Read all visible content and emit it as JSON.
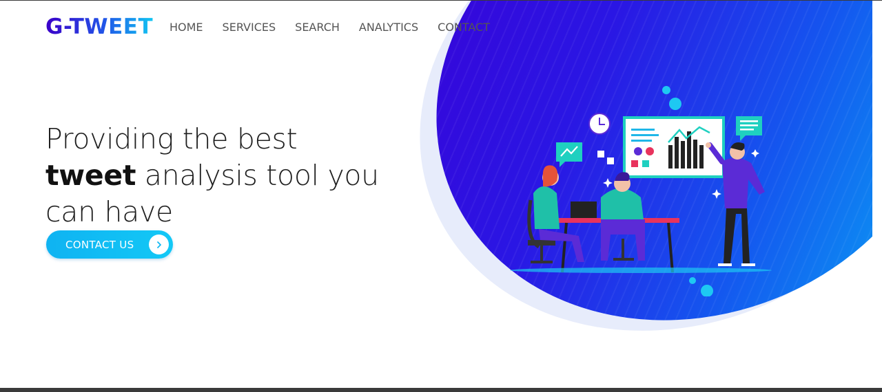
{
  "brand": {
    "logo_text": "G-TWEET"
  },
  "nav": {
    "items": [
      {
        "label": "HOME"
      },
      {
        "label": "SERVICES"
      },
      {
        "label": "SEARCH"
      },
      {
        "label": "ANALYTICS"
      },
      {
        "label": "CONTACT"
      }
    ]
  },
  "hero": {
    "headline_part1": "Providing the best",
    "headline_bold": "tweet",
    "headline_part2": " analysis tool you can have",
    "cta_label": "CONTACT US",
    "cta_icon": "chevron-right-icon",
    "illustration": "team-analytics-illustration"
  },
  "colors": {
    "brand_gradient_start": "#3b00c9",
    "brand_gradient_end": "#11c6f2",
    "hero_blob_start": "#3a00d6",
    "hero_blob_end": "#07b6f5",
    "cta": "#13c8f6",
    "nav_text": "#555555",
    "headline_text": "#1f1f1f"
  }
}
